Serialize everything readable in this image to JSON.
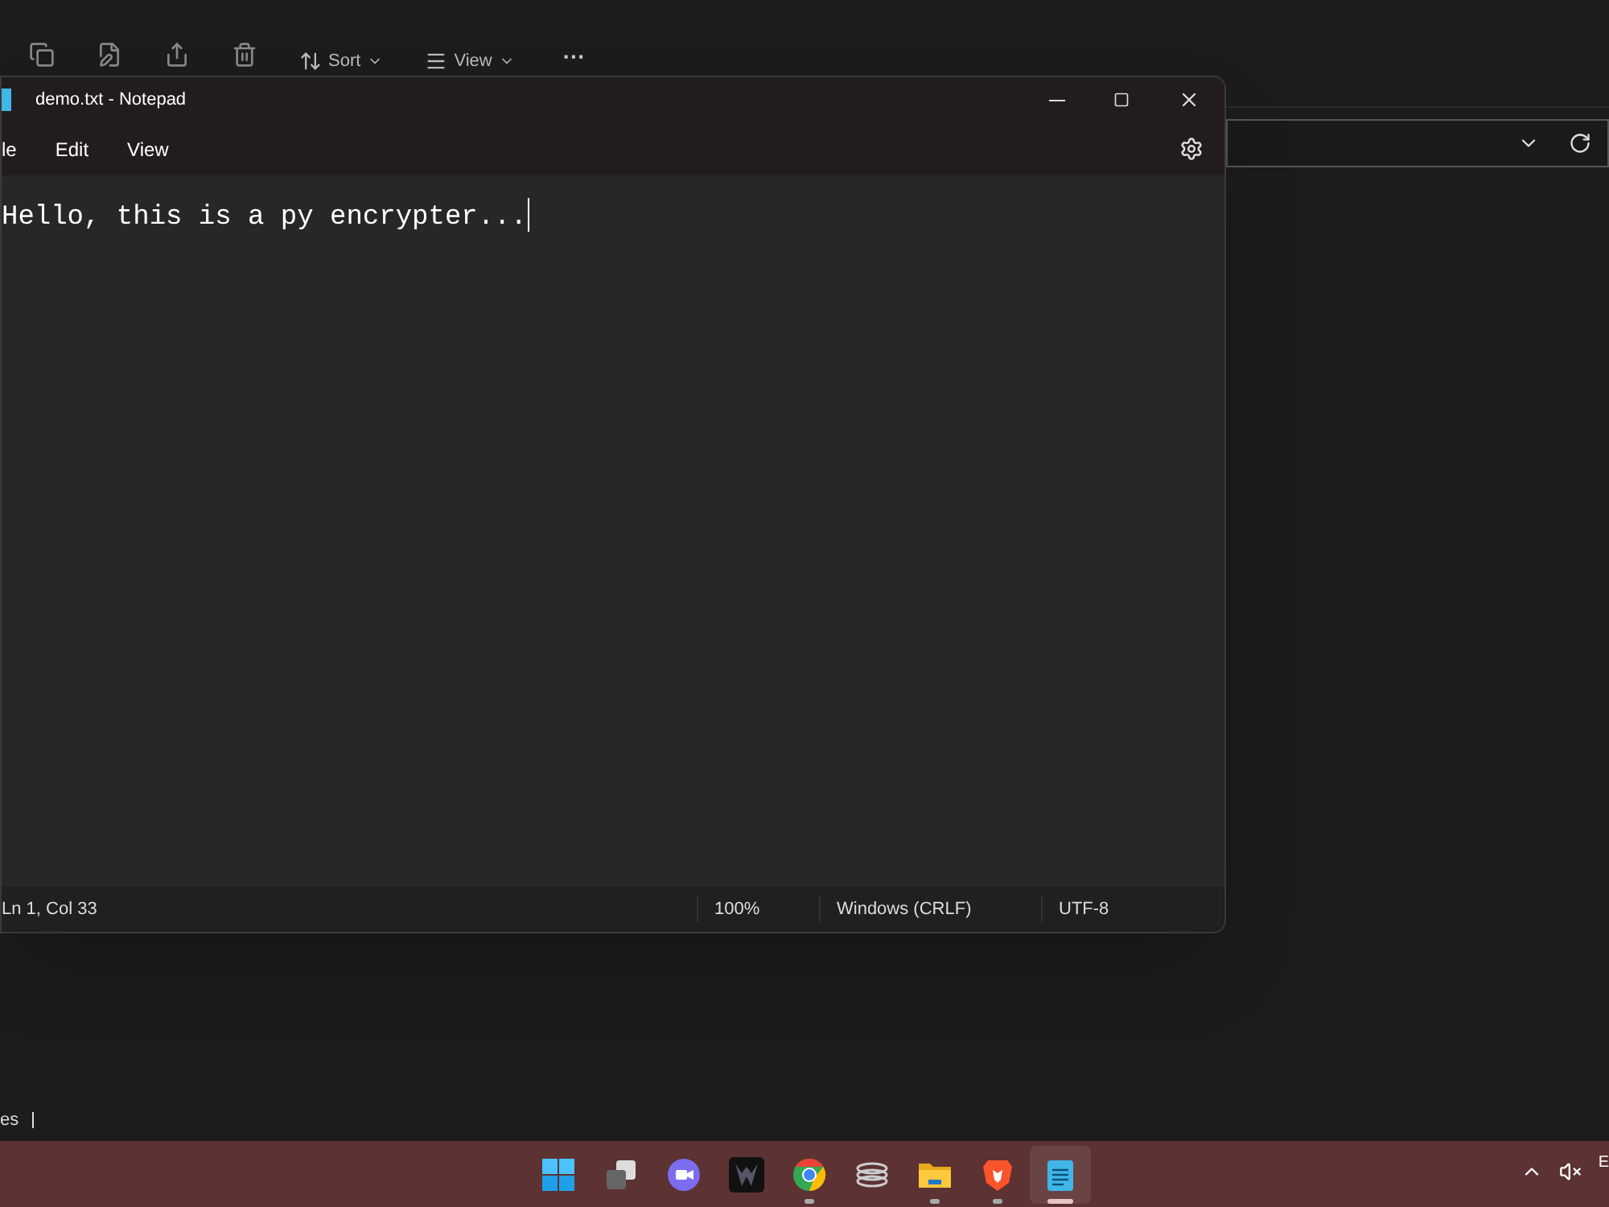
{
  "explorer": {
    "toolbar": [
      {
        "kind": "copy"
      },
      {
        "kind": "rename"
      },
      {
        "kind": "share"
      },
      {
        "kind": "delete"
      },
      {
        "kind": "sort",
        "label": "Sort"
      },
      {
        "kind": "view",
        "label": "View"
      },
      {
        "kind": "more",
        "label": "···"
      }
    ],
    "status": "es"
  },
  "notepad": {
    "title": "demo.txt - Notepad",
    "menu": [
      "le",
      "Edit",
      "View"
    ],
    "text": "Hello, this is a py encrypter...",
    "status": [
      "Ln 1, Col 33",
      "100%",
      "Windows (CRLF)",
      "UTF-8"
    ]
  },
  "taskbar": {
    "apps": [
      {
        "kind": "start",
        "running": false,
        "selected": false
      },
      {
        "kind": "taskview",
        "running": false,
        "selected": false
      },
      {
        "kind": "meet",
        "running": false,
        "selected": false
      },
      {
        "kind": "predator",
        "running": false,
        "selected": false
      },
      {
        "kind": "chrome",
        "running": true,
        "selected": false
      },
      {
        "kind": "coil",
        "running": false,
        "selected": false
      },
      {
        "kind": "folder",
        "running": true,
        "selected": false
      },
      {
        "kind": "brave",
        "running": true,
        "selected": false
      },
      {
        "kind": "notepad",
        "running": true,
        "selected": true
      }
    ],
    "tray_text": "E"
  }
}
